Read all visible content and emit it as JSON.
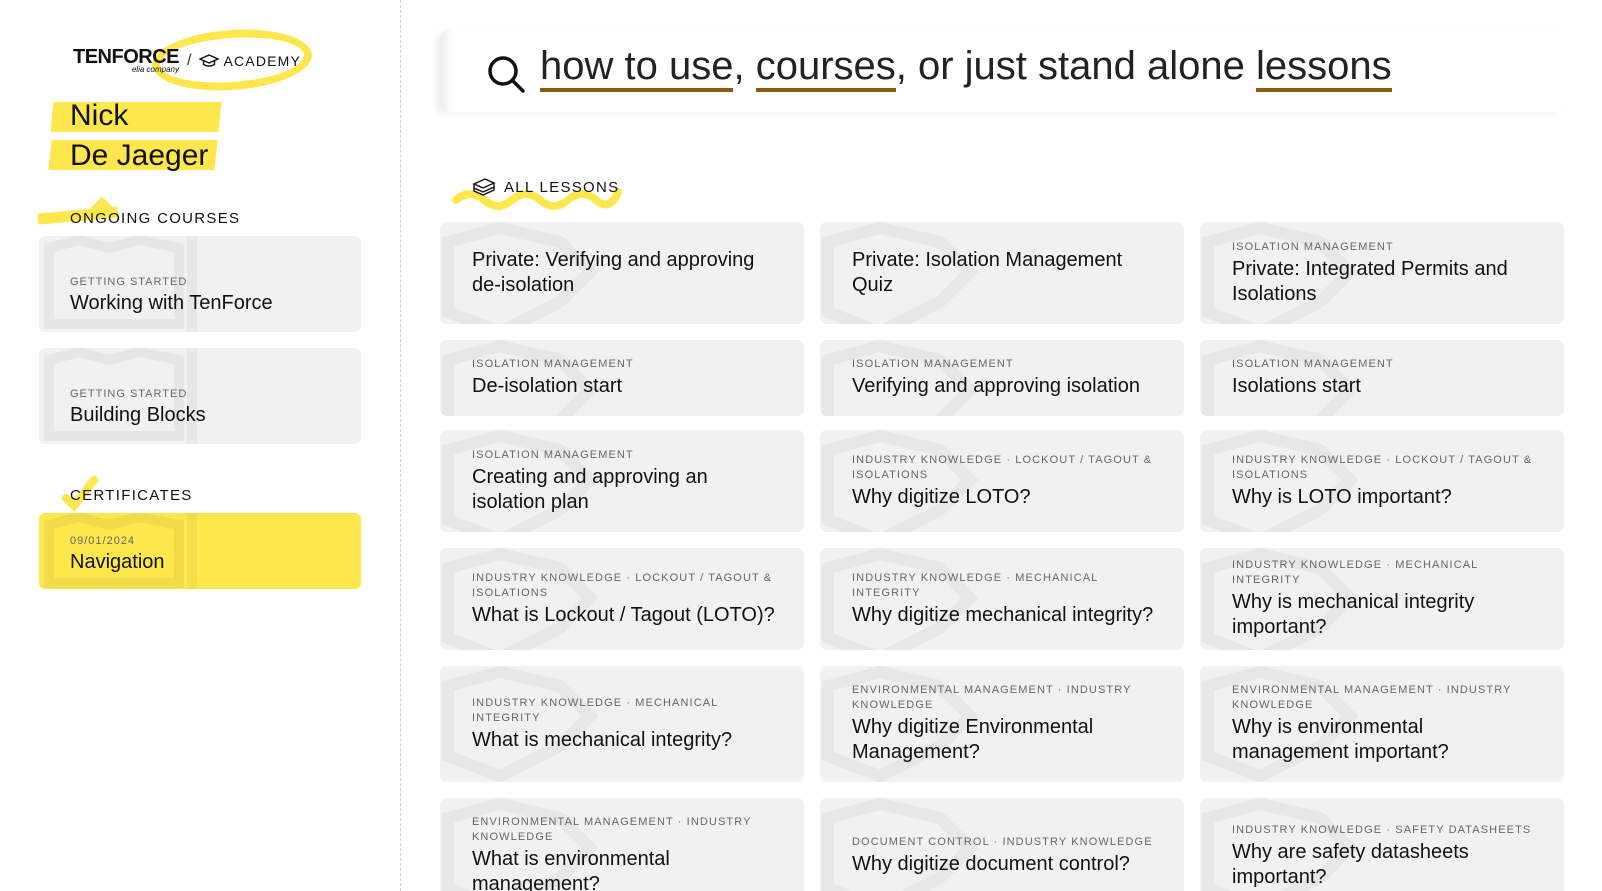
{
  "brand": {
    "name": "TENFORCE",
    "sub": "elia company",
    "separator": "/",
    "academy": "ACADEMY"
  },
  "user": {
    "first_name": "Nick",
    "last_name": "De Jaeger"
  },
  "ongoing": {
    "title": "ONGOING COURSES",
    "items": [
      {
        "category": "GETTING STARTED",
        "title": "Working with TenForce"
      },
      {
        "category": "GETTING STARTED",
        "title": "Building Blocks"
      }
    ]
  },
  "certificates": {
    "title": "CERTIFICATES",
    "items": [
      {
        "date": "09/01/2024",
        "title": "Navigation"
      }
    ]
  },
  "search": {
    "parts": [
      "how to use",
      ", ",
      "courses",
      ", or just stand alone ",
      "lessons"
    ]
  },
  "lessons": {
    "title": "ALL LESSONS",
    "items": [
      {
        "category": "",
        "title": "Private: Verifying and approving de-isolation"
      },
      {
        "category": "",
        "title": "Private: Isolation Management Quiz"
      },
      {
        "category": "ISOLATION MANAGEMENT",
        "title": "Private: Integrated Permits and Isolations"
      },
      {
        "category": "ISOLATION MANAGEMENT",
        "title": "De-isolation start"
      },
      {
        "category": "ISOLATION MANAGEMENT",
        "title": "Verifying and approving isolation"
      },
      {
        "category": "ISOLATION MANAGEMENT",
        "title": "Isolations start"
      },
      {
        "category": "ISOLATION MANAGEMENT",
        "title": "Creating and approving an isolation plan"
      },
      {
        "category": "INDUSTRY KNOWLEDGE · LOCKOUT / TAGOUT & ISOLATIONS",
        "title": "Why digitize LOTO?"
      },
      {
        "category": "INDUSTRY KNOWLEDGE · LOCKOUT / TAGOUT & ISOLATIONS",
        "title": "Why is LOTO important?"
      },
      {
        "category": "INDUSTRY KNOWLEDGE · LOCKOUT / TAGOUT & ISOLATIONS",
        "title": "What is Lockout / Tagout (LOTO)?"
      },
      {
        "category": "INDUSTRY KNOWLEDGE · MECHANICAL INTEGRITY",
        "title": "Why digitize mechanical integrity?"
      },
      {
        "category": "INDUSTRY KNOWLEDGE · MECHANICAL INTEGRITY",
        "title": "Why is mechanical integrity important?"
      },
      {
        "category": "INDUSTRY KNOWLEDGE · MECHANICAL INTEGRITY",
        "title": "What is mechanical integrity?"
      },
      {
        "category": "ENVIRONMENTAL MANAGEMENT · INDUSTRY KNOWLEDGE",
        "title": "Why digitize Environmental Management?"
      },
      {
        "category": "ENVIRONMENTAL MANAGEMENT · INDUSTRY KNOWLEDGE",
        "title": "Why is environmental management important?"
      },
      {
        "category": "ENVIRONMENTAL MANAGEMENT · INDUSTRY KNOWLEDGE",
        "title": "What is environmental management?"
      },
      {
        "category": "DOCUMENT CONTROL · INDUSTRY KNOWLEDGE",
        "title": "Why digitize document control?"
      },
      {
        "category": "INDUSTRY KNOWLEDGE · SAFETY DATASHEETS",
        "title": "Why are safety datasheets important?"
      }
    ]
  },
  "colors": {
    "highlight": "#fde74c",
    "card": "#f1f1f1",
    "underline": "#8a5a12"
  }
}
